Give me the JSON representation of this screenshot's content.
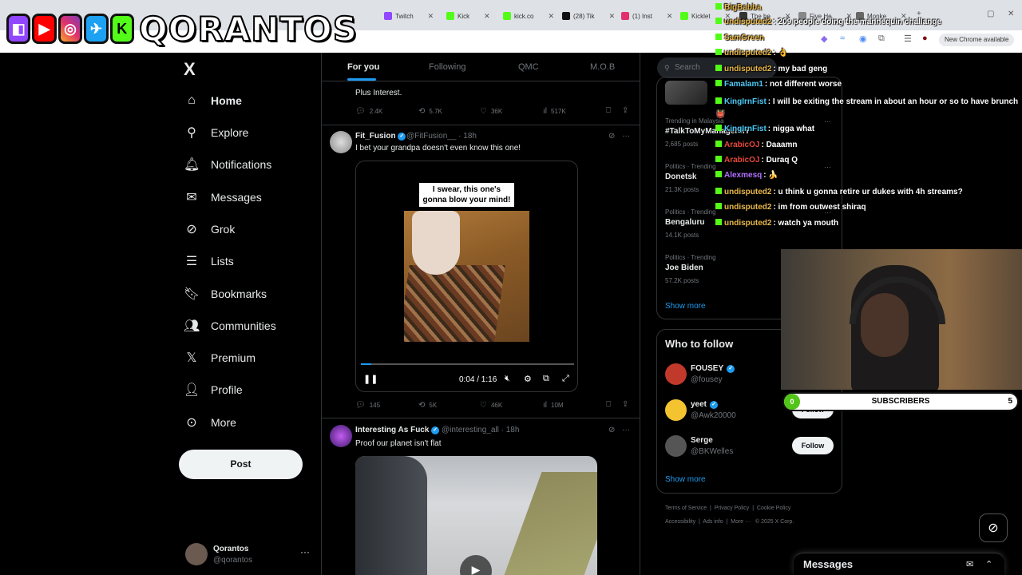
{
  "browser": {
    "tabs": [
      {
        "label": "Twitch",
        "color": "#9146ff"
      },
      {
        "label": "Kick",
        "color": "#53fc18"
      },
      {
        "label": "kick.co",
        "color": "#53fc18"
      },
      {
        "label": "(28) Tik",
        "color": "#111111"
      },
      {
        "label": "(1) Inst",
        "color": "#e1306c"
      },
      {
        "label": "Kicklet",
        "color": "#53fc18"
      },
      {
        "label": "The be",
        "color": "#333333"
      },
      {
        "label": "Five He",
        "color": "#888888"
      },
      {
        "label": "Monke",
        "color": "#666666"
      }
    ],
    "new_tab": "+",
    "new_chrome_label": "New Chrome available"
  },
  "banner": {
    "brand_text": "QORANTOS",
    "icons": [
      "twitch-icon",
      "youtube-icon",
      "instagram-icon",
      "twitter-icon",
      "kick-icon"
    ]
  },
  "sidebar": {
    "logo": "X",
    "items": [
      {
        "label": "Home",
        "icon": "home-icon",
        "glyph": "⌂",
        "active": true
      },
      {
        "label": "Explore",
        "icon": "search-icon",
        "glyph": "⚲"
      },
      {
        "label": "Notifications",
        "icon": "bell-icon",
        "glyph": "🔔︎"
      },
      {
        "label": "Messages",
        "icon": "mail-icon",
        "glyph": "✉"
      },
      {
        "label": "Grok",
        "icon": "grok-icon",
        "glyph": "⊘"
      },
      {
        "label": "Lists",
        "icon": "lists-icon",
        "glyph": "☰"
      },
      {
        "label": "Bookmarks",
        "icon": "bookmark-icon",
        "glyph": "🔖︎"
      },
      {
        "label": "Communities",
        "icon": "communities-icon",
        "glyph": "👥︎"
      },
      {
        "label": "Premium",
        "icon": "x-premium-icon",
        "glyph": "𝕏"
      },
      {
        "label": "Profile",
        "icon": "profile-icon",
        "glyph": "👤︎"
      },
      {
        "label": "More",
        "icon": "more-circle-icon",
        "glyph": "⊙"
      }
    ],
    "post_label": "Post",
    "account": {
      "name": "Qorantos",
      "handle": "@qorantos",
      "more": "···"
    }
  },
  "feed": {
    "tabs": [
      "For you",
      "Following",
      "QMC",
      "M.O.B"
    ],
    "prev_tweet": {
      "text": "Plus Interest.",
      "replies": "2.4K",
      "reposts": "5.7K",
      "likes": "36K",
      "views": "517K"
    },
    "tweet1": {
      "name": "Fit_Fusion",
      "handle": "@FitFusion__ · 18h",
      "text": "I bet your grandpa doesn't even know this one!",
      "video_caption": "I swear, this one's gonna blow your mind!",
      "video_time": "0:04 / 1:16",
      "progress": 0.05,
      "replies": "145",
      "reposts": "5K",
      "likes": "46K",
      "views": "10M"
    },
    "tweet2": {
      "name": "Interesting As Fuck",
      "handle": "@interesting_all · 18h",
      "text": "Proof our planet isn't flat"
    }
  },
  "right": {
    "search_placeholder": "Search",
    "trends": [
      {
        "category": "Trending in Malaysia",
        "name": "#TalkToMyManagerMY",
        "count": "2,685 posts"
      },
      {
        "category": "Politics · Trending",
        "name": "Donetsk",
        "count": "21.3K posts"
      },
      {
        "category": "Politics · Trending",
        "name": "Bengaluru",
        "count": "14.1K posts"
      },
      {
        "category": "Politics · Trending",
        "name": "Joe Biden",
        "count": "57.2K posts"
      }
    ],
    "show_more": "Show more",
    "who_to_follow_title": "Who to follow",
    "who_to_follow": [
      {
        "name": "FOUSEY",
        "handle": "@fousey",
        "follow": "Follow",
        "color": "#c0392b"
      },
      {
        "name": "yeet",
        "handle": "@Awk20000",
        "follow": "Follow",
        "color": "#f4c430"
      },
      {
        "name": "Serge",
        "handle": "@BKWelles",
        "follow": "Follow",
        "color": "#555555"
      }
    ],
    "footer_line1": [
      "Terms of Service",
      "Privacy Policy",
      "Cookie Policy"
    ],
    "footer_line2": [
      "Accessibility",
      "Ads info",
      "More ···",
      "© 2025 X Corp."
    ]
  },
  "chat": [
    {
      "user": "BigBabba",
      "msg": "",
      "color": "#e8b84a"
    },
    {
      "user": "undisputed2",
      "msg": ": 209 people doing the mannequin challange",
      "color": "#e8b84a"
    },
    {
      "user": "SamGreen",
      "msg": "",
      "color": "#e8b84a"
    },
    {
      "user": "undisputed2",
      "msg": ": 👌",
      "color": "#e8b84a"
    },
    {
      "user": "undisputed2",
      "msg": ": my bad geng",
      "color": "#e8b84a"
    },
    {
      "user": "Famalam1",
      "msg": ": not different worse",
      "color": "#4ec9f5"
    },
    {
      "user": "KingIrnFist",
      "msg": ": I will be exiting the stream in about an hour or so to have brunch 👹",
      "color": "#4ec9f5"
    },
    {
      "user": "KingIrnFist",
      "msg": ": nigga what",
      "color": "#4ec9f5"
    },
    {
      "user": "ArabicOJ",
      "msg": ": Daaamn",
      "color": "#e8473b"
    },
    {
      "user": "ArabicOJ",
      "msg": ": Duraq Q",
      "color": "#e8473b"
    },
    {
      "user": "Alexmesq",
      "msg": ": 🍌",
      "color": "#b070ff"
    },
    {
      "user": "undisputed2",
      "msg": ": u think u gonna retire ur dukes with 4h streams?",
      "color": "#e8b84a"
    },
    {
      "user": "undisputed2",
      "msg": ": im from outwest shiraq",
      "color": "#e8b84a"
    },
    {
      "user": "undisputed2",
      "msg": ": watch ya mouth",
      "color": "#e8b84a"
    }
  ],
  "overlay": {
    "subs_label": "SUBSCRIBERS",
    "subs_current": "0",
    "subs_goal": "5"
  },
  "messages_drawer": {
    "title": "Messages"
  }
}
